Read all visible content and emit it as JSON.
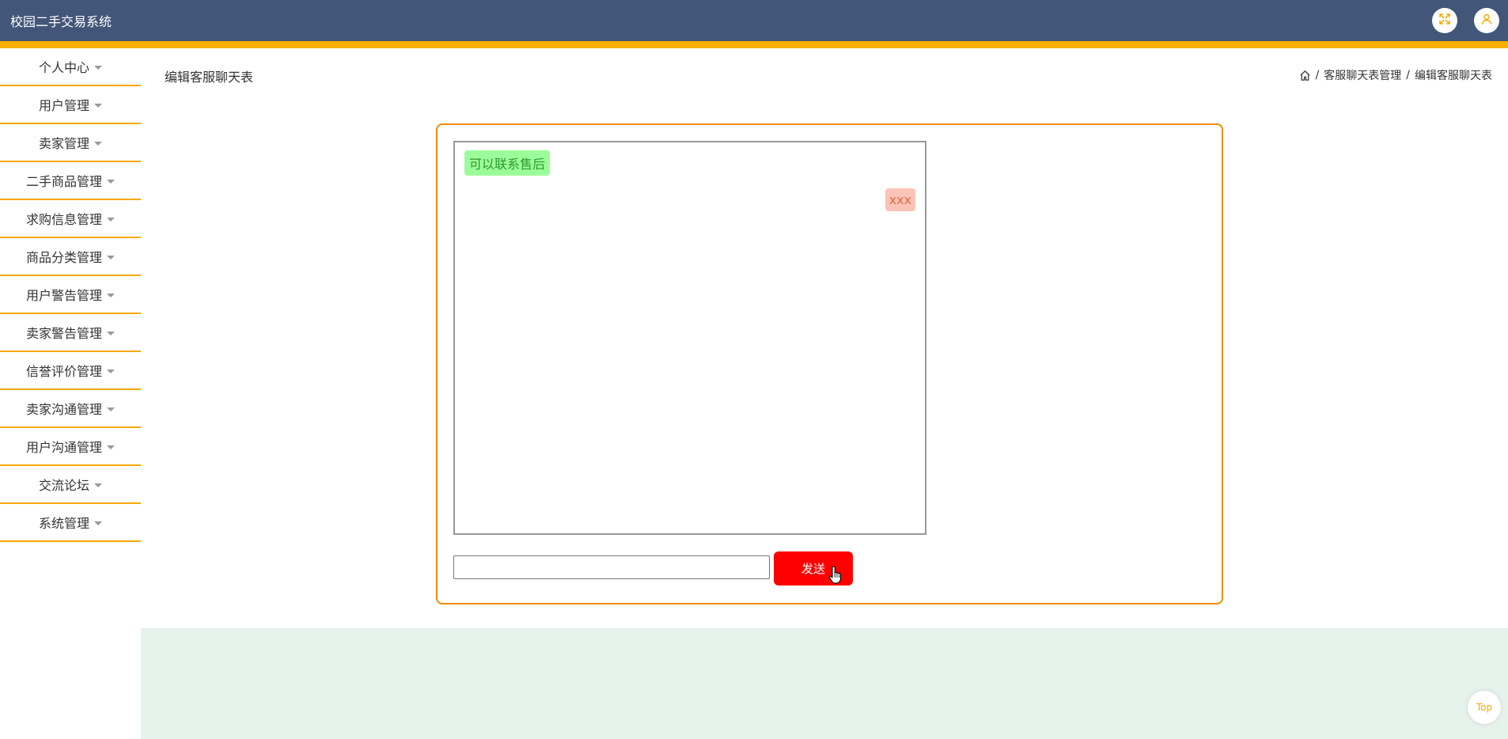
{
  "app": {
    "title": "校园二手交易系统"
  },
  "header": {
    "fullscreen_icon": "fullscreen-icon",
    "user_icon": "user-icon",
    "accent_color": "#f9b000",
    "bar_color": "#425679"
  },
  "sidebar": {
    "items": [
      {
        "label": "个人中心"
      },
      {
        "label": "用户管理"
      },
      {
        "label": "卖家管理"
      },
      {
        "label": "二手商品管理"
      },
      {
        "label": "求购信息管理"
      },
      {
        "label": "商品分类管理"
      },
      {
        "label": "用户警告管理"
      },
      {
        "label": "卖家警告管理"
      },
      {
        "label": "信誉评价管理"
      },
      {
        "label": "卖家沟通管理"
      },
      {
        "label": "用户沟通管理"
      },
      {
        "label": "交流论坛"
      },
      {
        "label": "系统管理"
      }
    ]
  },
  "page": {
    "title": "编辑客服聊天表",
    "breadcrumb": {
      "separator": "/",
      "level1": "客服聊天表管理",
      "level2": "编辑客服聊天表"
    }
  },
  "chat": {
    "messages": [
      {
        "side": "left",
        "text": "可以联系售后"
      },
      {
        "side": "right",
        "text": "xxx"
      }
    ],
    "input": {
      "value": "",
      "placeholder": ""
    },
    "send_label": "发送"
  },
  "back_to_top": {
    "label": "Top"
  }
}
